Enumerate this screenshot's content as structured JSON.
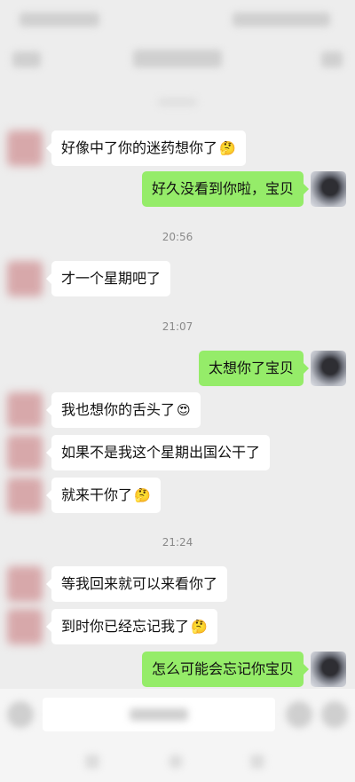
{
  "chat": {
    "messages": [
      {
        "text": "好像中了你的迷药想你了",
        "emoji": "🤔"
      },
      {
        "text": "好久没看到你啦，宝贝"
      },
      {
        "time": "20:56"
      },
      {
        "text": "才一个星期吧了"
      },
      {
        "time": "21:07"
      },
      {
        "text": "太想你了宝贝"
      },
      {
        "text": "我也想你的舌头了",
        "emoji": "😍"
      },
      {
        "text": "如果不是我这个星期出国公干了"
      },
      {
        "text": "就来干你了",
        "emoji": "🤔"
      },
      {
        "time": "21:24"
      },
      {
        "text": "等我回来就可以来看你了"
      },
      {
        "text": "到时你已经忘记我了",
        "emoji": "🤔"
      },
      {
        "text": "怎么可能会忘记你宝贝"
      }
    ]
  },
  "colors": {
    "background": "#ededed",
    "incoming_bubble": "#ffffff",
    "outgoing_bubble": "#95ec69",
    "timestamp": "#8a8a8a"
  },
  "icons": {
    "back": "back-icon",
    "more": "more-icon",
    "voice": "voice-icon",
    "emoji": "emoji-icon",
    "add": "plus-icon"
  }
}
